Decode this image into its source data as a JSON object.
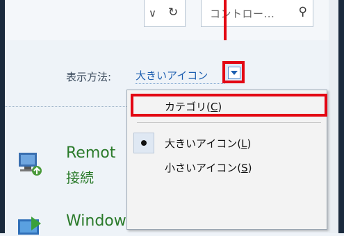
{
  "toolbar": {
    "search_placeholder": "コントロー...",
    "address_dropdown_icon": "chevron-down-icon",
    "refresh_icon": "refresh-icon",
    "search_icon": "search-icon"
  },
  "view": {
    "label": "表示方法:",
    "selected": "大きいアイコン"
  },
  "menu": {
    "items": [
      {
        "label": "カテゴリ",
        "accel": "C"
      },
      {
        "label": "大きいアイコン",
        "accel": "L",
        "selected": true
      },
      {
        "label": "小さいアイコン",
        "accel": "S"
      }
    ]
  },
  "items": {
    "remote": {
      "title": "Remot",
      "subtitle": "接続"
    },
    "windows_update": {
      "title": "Windows Update"
    }
  },
  "colors": {
    "highlight": "#e30613",
    "link_green": "#2a7a2a",
    "link_blue": "#1e5fb0"
  }
}
